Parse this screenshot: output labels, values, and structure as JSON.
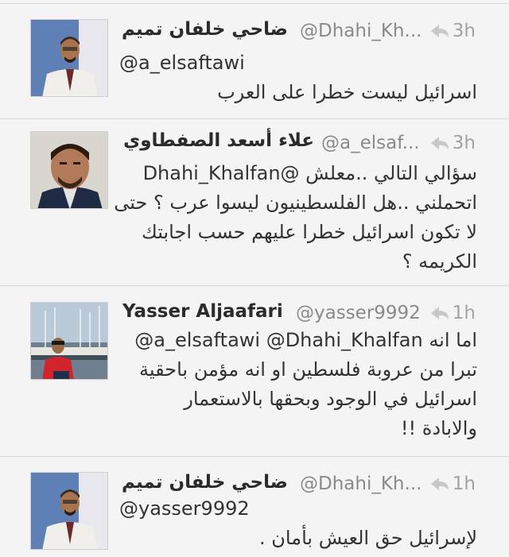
{
  "tweets": [
    {
      "name": "ضاحي خلفان تميم",
      "handle": "@Dhahi_Kh...",
      "time": "3h",
      "avatar": "avatar-man-white-uniform",
      "lines": [
        "@a_elsaftawi",
        "اسرائيل ليست خطرا على العرب"
      ]
    },
    {
      "name": "علاء أسعد الصفطاوي",
      "handle": "@a_elsaf...",
      "time": "3h",
      "avatar": "avatar-man-portrait",
      "lines": [
        "سؤالي التالي ..معلش @Dhahi_Khalfan",
        "اتحملني ..هل الفلسطينيون ليسوا عرب ؟ حتى",
        "لا تكون اسرائيل خطرا عليهم حسب اجابتك",
        "الكريمه ؟"
      ]
    },
    {
      "name": "Yasser Aljaafari",
      "handle": "@yasser9992",
      "time": "1h",
      "avatar": "avatar-man-harbor",
      "lines": [
        "@a_elsaftawi @Dhahi_Khalfan اما انه",
        "تبرا من عروبة فلسطين او انه مؤمن باحقية",
        "اسرائيل في الوجود وبحقها بالاستعمار",
        "والابادة !!"
      ]
    },
    {
      "name": "ضاحي خلفان تميم",
      "handle": "@Dhahi_Kh...",
      "time": "1h",
      "avatar": "avatar-man-white-uniform",
      "lines": [
        "@yasser9992",
        "لإسرائيل حق العيش بأمان ."
      ]
    }
  ],
  "colors": {
    "background": "#f4f4f4",
    "separator": "#d6d6d6",
    "name": "#2b2b2b",
    "handle": "#8a8a8a",
    "time": "#a2a2a2"
  }
}
